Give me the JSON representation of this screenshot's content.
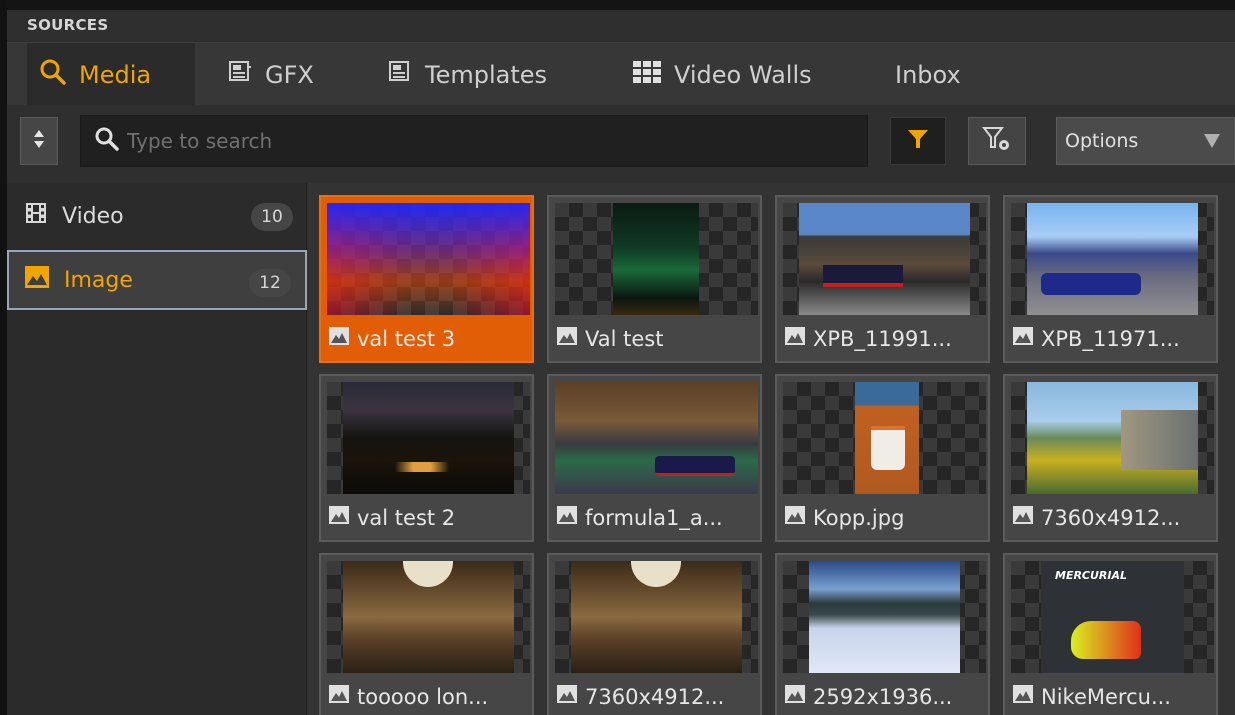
{
  "panel": {
    "title": "SOURCES"
  },
  "tabs": [
    {
      "label": "Media",
      "icon": "search-icon",
      "active": true
    },
    {
      "label": "GFX",
      "icon": "gfx-icon"
    },
    {
      "label": "Templates",
      "icon": "template-icon"
    },
    {
      "label": "Video Walls",
      "icon": "video-wall-icon"
    },
    {
      "label": "Inbox"
    }
  ],
  "toolbar": {
    "search_placeholder": "Type to search",
    "options_label": "Options",
    "accent": "#f0a500"
  },
  "sidebar": {
    "items": [
      {
        "label": "Video",
        "count": "10",
        "icon": "film-icon"
      },
      {
        "label": "Image",
        "count": "12",
        "icon": "image-icon",
        "selected": true
      }
    ]
  },
  "media": {
    "items": [
      {
        "label": "val test 3",
        "selected": true
      },
      {
        "label": "Val test"
      },
      {
        "label": "XPB_11991..."
      },
      {
        "label": "XPB_11971..."
      },
      {
        "label": "val test 2"
      },
      {
        "label": "formula1_a..."
      },
      {
        "label": "Kopp.jpg"
      },
      {
        "label": "7360x4912..."
      },
      {
        "label": "tooooo lon..."
      },
      {
        "label": "7360x4912..."
      },
      {
        "label": "2592x1936..."
      },
      {
        "label": "NikeMercu..."
      }
    ],
    "overlay_text": {
      "nike_brand": "MERCURIAL"
    }
  }
}
